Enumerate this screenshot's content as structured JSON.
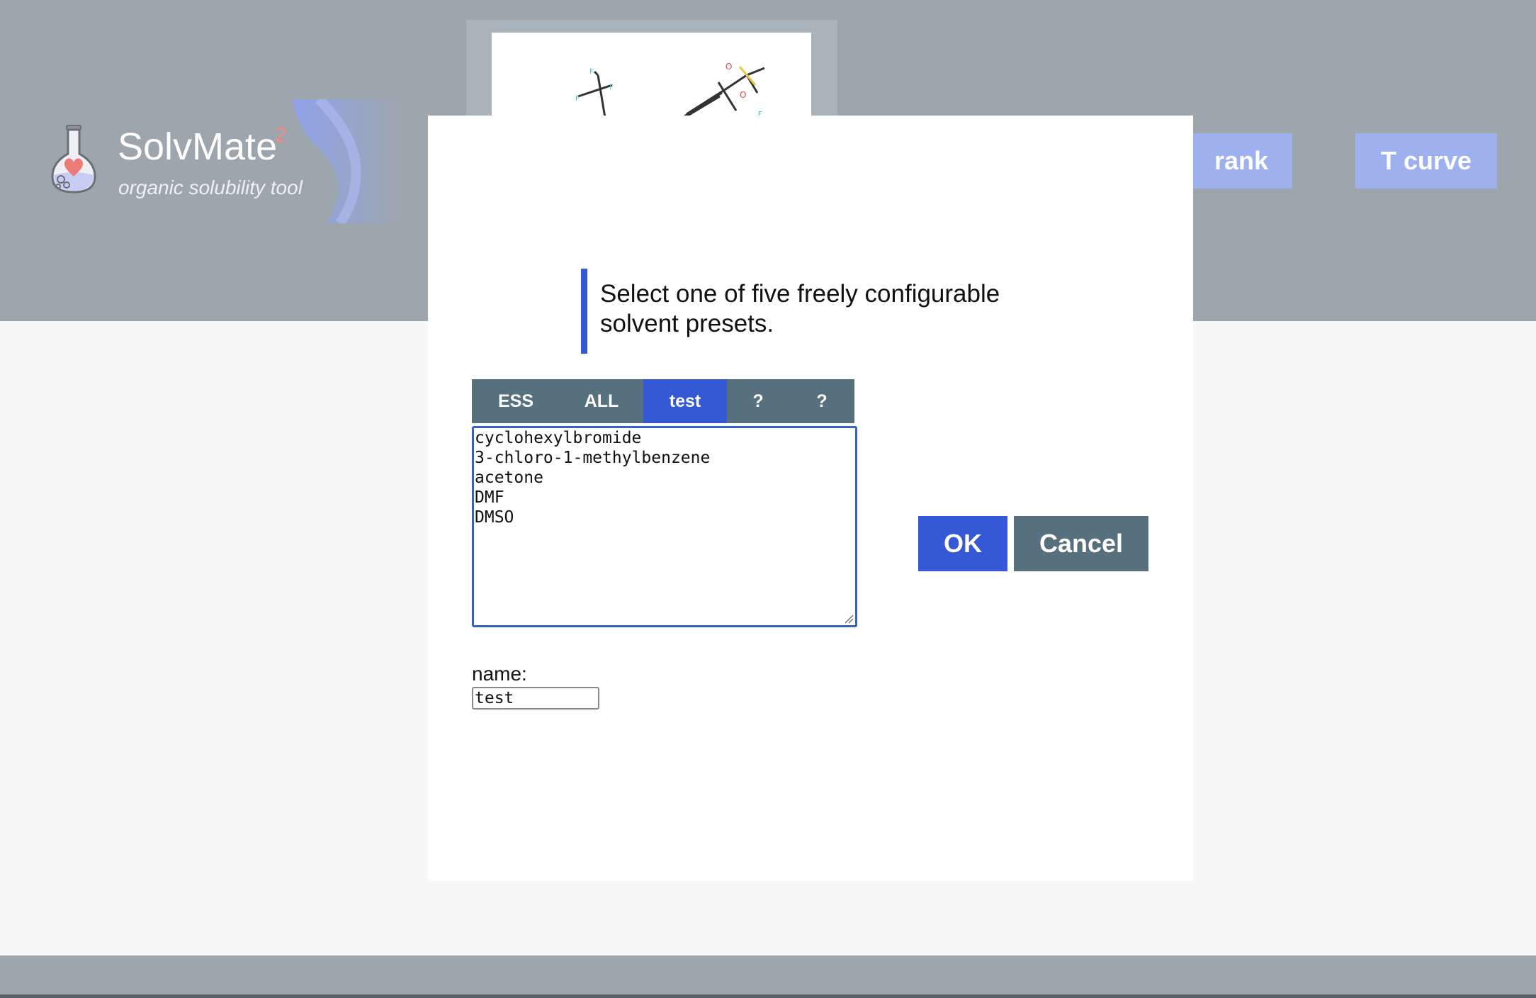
{
  "app": {
    "title": "SolvMate",
    "superscript": "2",
    "subtitle": "organic solubility tool"
  },
  "header": {
    "rank_label": "rank",
    "tcurve_label": "T curve"
  },
  "modal": {
    "instruction": "Select one of five freely configurable solvent presets.",
    "tabs": [
      {
        "label": "ESS",
        "active": false
      },
      {
        "label": "ALL",
        "active": false
      },
      {
        "label": "test",
        "active": true
      },
      {
        "label": "?",
        "active": false
      },
      {
        "label": "?",
        "active": false
      }
    ],
    "solvent_list": "cyclohexylbromide\n3-chloro-1-methylbenzene\nacetone\nDMF\nDMSO",
    "name_label": "name:",
    "name_value": "test",
    "ok_label": "OK",
    "cancel_label": "Cancel"
  },
  "colors": {
    "accent": "#3458d6",
    "secondary": "#56707e",
    "header_bg": "#9ea6ad",
    "header_button": "#9fb0ef"
  },
  "icons": [
    "flask-heart-logo-icon",
    "molecule-structure-icon",
    "resize-grip-icon"
  ]
}
